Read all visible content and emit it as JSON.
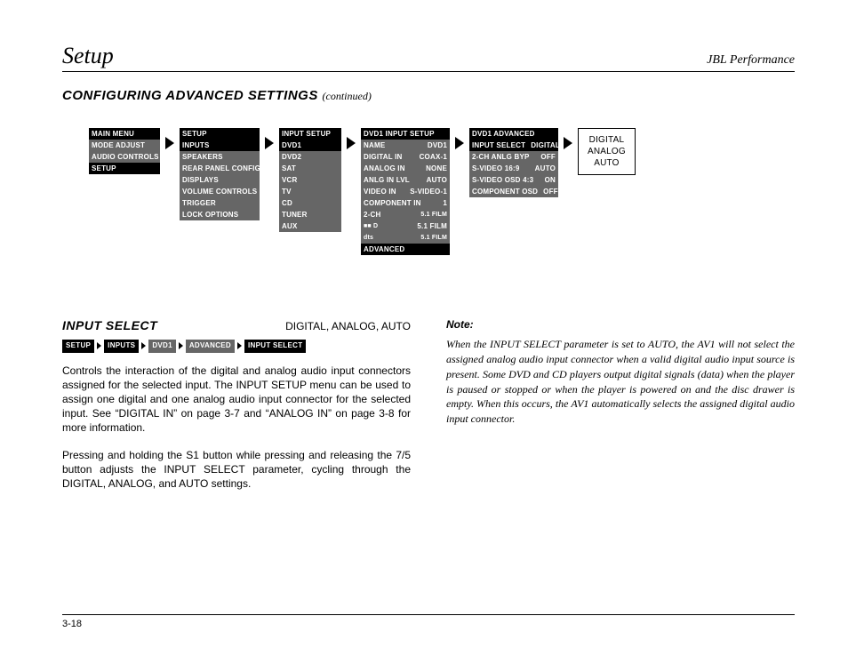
{
  "header": {
    "title": "Setup",
    "brand": "JBL Performance"
  },
  "section": {
    "heading": "CONFIGURING ADVANCED SETTINGS",
    "continued": "(continued)"
  },
  "menus": {
    "m1": {
      "title": "MAIN MENU",
      "rows": [
        "MODE ADJUST",
        "AUDIO CONTROLS"
      ],
      "sel": "SETUP"
    },
    "m2": {
      "title": "SETUP",
      "sel": "INPUTS",
      "rows": [
        "SPEAKERS",
        "REAR PANEL CONFIG",
        "DISPLAYS",
        "VOLUME CONTROLS",
        "TRIGGER",
        "LOCK OPTIONS"
      ]
    },
    "m3": {
      "title": "INPUT SETUP",
      "sel": "DVD1",
      "rows": [
        "DVD2",
        "SAT",
        "VCR",
        "TV",
        "CD",
        "TUNER",
        "AUX"
      ]
    },
    "m4": {
      "title": "DVD1 INPUT SETUP",
      "pairs": [
        [
          "NAME",
          "DVD1"
        ],
        [
          "DIGITAL IN",
          "COAX-1"
        ],
        [
          "ANALOG IN",
          "NONE"
        ],
        [
          "ANLG IN LVL",
          "AUTO"
        ],
        [
          "VIDEO IN",
          "S-VIDEO-1"
        ],
        [
          "COMPONENT IN",
          "1"
        ],
        [
          "2-CH",
          "5.1 FILM"
        ],
        [
          "■■ D",
          "5.1 FILM"
        ],
        [
          "dts",
          "5.1 FILM"
        ]
      ],
      "sel": "ADVANCED"
    },
    "m5": {
      "title": "DVD1 ADVANCED",
      "sel": [
        "INPUT SELECT",
        "DIGITAL"
      ],
      "pairs": [
        [
          "2-CH ANLG BYP",
          "OFF"
        ],
        [
          "S-VIDEO 16:9",
          "AUTO"
        ],
        [
          "S-VIDEO OSD 4:3",
          "ON"
        ],
        [
          "COMPONENT OSD",
          "OFF"
        ]
      ]
    },
    "m6": {
      "l1": "DIGITAL",
      "l2": "ANALOG",
      "l3": "AUTO"
    }
  },
  "left": {
    "subhead": "INPUT SELECT",
    "opts": "DIGITAL, ANALOG, AUTO",
    "crumbs": [
      "SETUP",
      "INPUTS",
      "DVD1",
      "ADVANCED",
      "INPUT SELECT"
    ],
    "p1": "Controls the interaction of the digital and analog audio input connectors assigned for the selected input. The INPUT SETUP menu can be used to assign one digital and one analog audio input connector for the selected input. See “DIGITAL IN” on page 3-7 and “ANALOG IN” on page 3-8 for more information.",
    "p2": "Pressing and holding the S1 button while pressing and releasing the 7/5 button adjusts the INPUT SELECT parameter, cycling through the DIGITAL, ANALOG, and AUTO settings."
  },
  "right": {
    "note": "Note:",
    "body": "When the INPUT SELECT parameter is set to AUTO, the AV1 will not select the assigned analog audio input connector when a valid digital audio input source is present. Some DVD and CD players output digital signals (data) when the player is paused or stopped or when the player is powered on and the disc drawer is empty. When this occurs, the AV1 automatically selects the assigned digital audio input connector."
  },
  "footer": {
    "page": "3-18"
  }
}
